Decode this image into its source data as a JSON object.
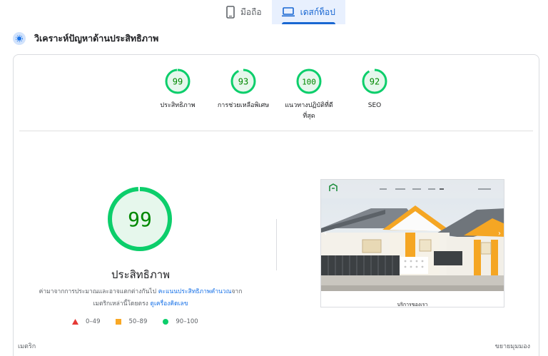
{
  "device_tabs": [
    {
      "label": "มือถือ",
      "icon": "mobile-icon",
      "active": false
    },
    {
      "label": "เดสก์ท็อป",
      "icon": "desktop-icon",
      "active": true
    }
  ],
  "section": {
    "title": "วิเคราะห์ปัญหาด้านประสิทธิภาพ",
    "icon": "diagnostics-icon"
  },
  "scores": [
    {
      "value": "99",
      "score": 99,
      "label": "ประสิทธิภาพ"
    },
    {
      "value": "93",
      "score": 93,
      "label": "การช่วยเหลือพิเศษ"
    },
    {
      "value": "100",
      "score": 100,
      "label": "แนวทางปฏิบัติที่ดีที่สุด"
    },
    {
      "value": "92",
      "score": 92,
      "label": "SEO"
    }
  ],
  "main_score": {
    "value": "99",
    "score": 99,
    "title": "ประสิทธิภาพ"
  },
  "description": {
    "text_before": "ค่ามาจากการประมาณและอาจแตกต่างกันไป ",
    "link1": "คะแนนประสิทธิภาพคำนวณ",
    "text_middle": "จากเมตริกเหล่านี้โดยตรง ",
    "link2": "ดูเครื่องคิดเลข"
  },
  "legend": [
    {
      "range": "0–49",
      "color": "#e53935"
    },
    {
      "range": "50–89",
      "color": "#f9a825"
    },
    {
      "range": "90–100",
      "color": "#0cce6b"
    }
  ],
  "screenshot_caption": "บริการของเรา",
  "metrics_label": "เมตริก",
  "expand_label": "ขยายมุมมอง",
  "colors": {
    "pass": "#0cce6b",
    "pass_bg": "#e6f7ec",
    "pass_text": "#008800",
    "accent": "#1967d2"
  }
}
